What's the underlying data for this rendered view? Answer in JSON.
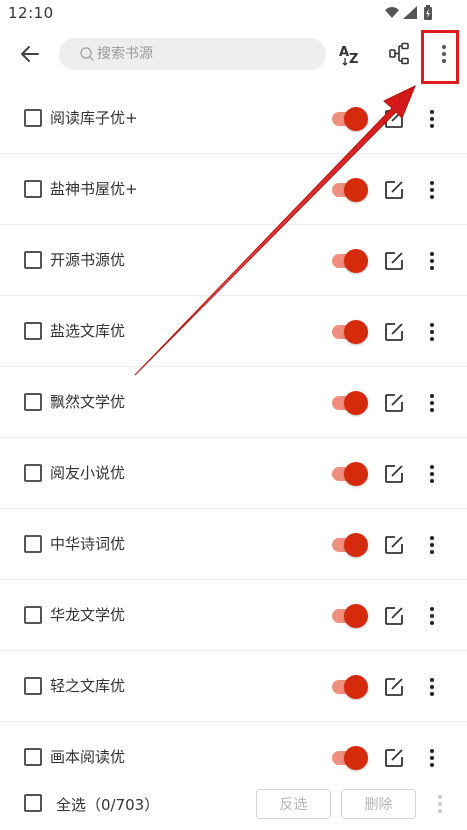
{
  "status_bar": {
    "time": "12:10",
    "icons": [
      "wifi-icon",
      "signal-icon",
      "battery-charging-icon"
    ]
  },
  "toolbar": {
    "back_icon": "arrow-left-icon",
    "search_placeholder": "搜索书源",
    "search_value": "",
    "sort_icon": "sort-az-icon",
    "group_icon": "group-icon",
    "more_icon": "more-vertical-icon"
  },
  "sources": [
    {
      "name": "阅读库子优+",
      "enabled": true,
      "checked": false
    },
    {
      "name": "盐神书屋优+",
      "enabled": true,
      "checked": false
    },
    {
      "name": "开源书源优",
      "enabled": true,
      "checked": false
    },
    {
      "name": "盐选文库优",
      "enabled": true,
      "checked": false
    },
    {
      "name": "飘然文学优",
      "enabled": true,
      "checked": false
    },
    {
      "name": "阅友小说优",
      "enabled": true,
      "checked": false
    },
    {
      "name": "中华诗词优",
      "enabled": true,
      "checked": false
    },
    {
      "name": "华龙文学优",
      "enabled": true,
      "checked": false
    },
    {
      "name": "轻之文库优",
      "enabled": true,
      "checked": false
    },
    {
      "name": "画本阅读优",
      "enabled": true,
      "checked": false
    }
  ],
  "bottom_bar": {
    "select_all_label": "全选（0/703）",
    "invert_label": "反选",
    "delete_label": "删除"
  },
  "colors": {
    "accent": "#d62a0c",
    "switch_track": "#f08f7f",
    "annotation": "#e01b1b"
  }
}
